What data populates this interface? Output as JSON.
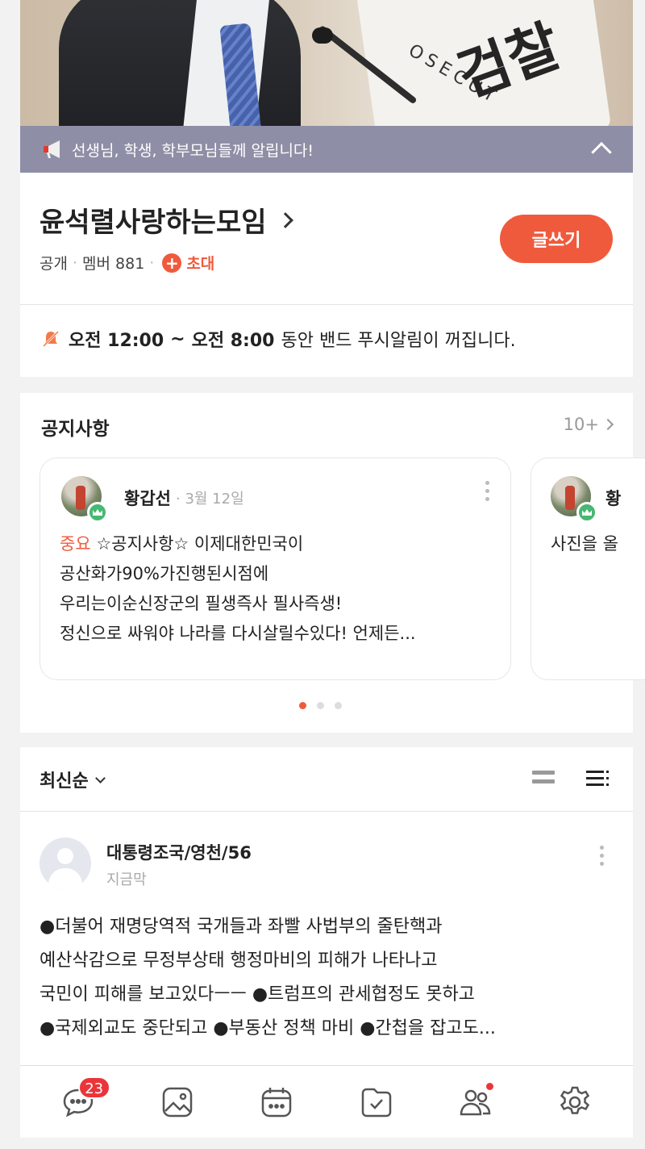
{
  "announcement": {
    "text": "선생님, 학생, 학부모님들께 알립니다!",
    "icon": "megaphone-icon"
  },
  "cover": {
    "flag_text": "OSECUT",
    "flag_glyph": "검찰"
  },
  "band": {
    "title": "윤석렬사랑하는모임",
    "visibility": "공개",
    "members_label": "멤버 881",
    "invite_label": "초대",
    "write_button": "글쓰기"
  },
  "quiet_hours": {
    "start": "오전 12:00",
    "sep": "~",
    "end": "오전 8:00",
    "rest": "동안 밴드 푸시알림이 꺼집니다."
  },
  "notices": {
    "heading": "공지사항",
    "more": "10+",
    "cards": [
      {
        "author": "황갑선",
        "date": "· 3월 12일",
        "tag": "중요",
        "lines": [
          "☆공지사항☆ 이제대한민국이",
          "공산화가90%가진행된시점에",
          "우리는이순신장군의 필생즉사 필사즉생!",
          "정신으로 싸워야 나라를 다시살릴수있다! 언제든..."
        ]
      },
      {
        "author": "황",
        "lines": [
          "사진을 올"
        ]
      }
    ],
    "pager": {
      "count": 3,
      "active": 0
    }
  },
  "feed": {
    "sort_label": "최신순",
    "post": {
      "author": "대통령조국/영천/56",
      "time": "지금막",
      "lines": [
        "●더불어 재명당역적 국개들과 좌빨 사법부의 줄탄핵과",
        "예산삭감으로 무정부상태  행정마비의 피해가 나타나고",
        "국민이  피해를 보고있다ㅡㅡ ●트럼프의  관세협정도 못하고",
        "●국제외교도  중단되고 ●부동산 정책 마비 ●간첩을 잡고도..."
      ]
    }
  },
  "bottom_nav": {
    "items": [
      "chat-icon",
      "photo-icon",
      "calendar-icon",
      "folder-check-icon",
      "members-icon",
      "settings-icon"
    ],
    "chat_badge": "23"
  },
  "colors": {
    "accent": "#f05a3c",
    "announce_bg": "#8e8fa6",
    "badge": "#e9363a",
    "crown": "#47b872"
  }
}
